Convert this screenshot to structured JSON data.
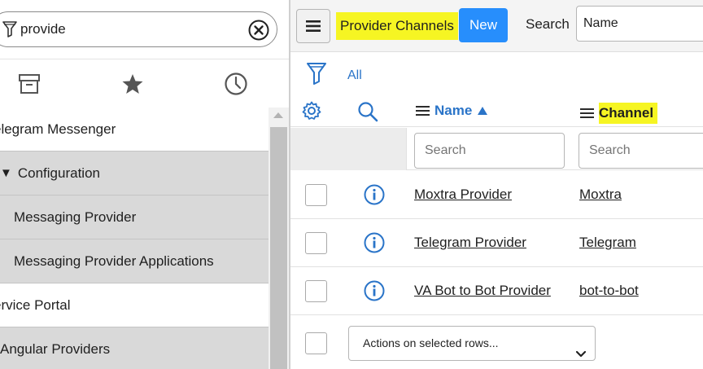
{
  "navigator": {
    "filter_value": "provide",
    "tabs": [
      {
        "icon": "archive-icon",
        "label": "All"
      },
      {
        "icon": "star-icon",
        "label": "Favorites"
      },
      {
        "icon": "clock-icon",
        "label": "History"
      }
    ],
    "items": [
      {
        "label": "elegram Messenger",
        "level": "l0"
      },
      {
        "label": "Configuration",
        "level": "l1",
        "expanded": true
      },
      {
        "label": "Messaging Provider",
        "level": "l2"
      },
      {
        "label": "Messaging Provider Applications",
        "level": "l2"
      },
      {
        "label": "ervice Portal",
        "level": "l0"
      },
      {
        "label": "Angular Providers",
        "level": "l0b"
      }
    ],
    "expand_glyph": "▼"
  },
  "list": {
    "title": "Provider Channels",
    "new_label": "New",
    "search_label": "Search",
    "search_field_value": "Name",
    "filter_all": "All",
    "columns": {
      "name": "Name",
      "channel": "Channel"
    },
    "column_search_placeholder": "Search",
    "rows": [
      {
        "name": "Moxtra Provider",
        "channel": "Moxtra"
      },
      {
        "name": "Telegram Provider",
        "channel": "Telegram"
      },
      {
        "name": "VA Bot to Bot Provider",
        "channel": "bot-to-bot"
      }
    ],
    "actions_label": "Actions on selected rows..."
  },
  "colors": {
    "highlight": "#f6f523",
    "primary": "#278efc",
    "link": "#2a74c8"
  }
}
